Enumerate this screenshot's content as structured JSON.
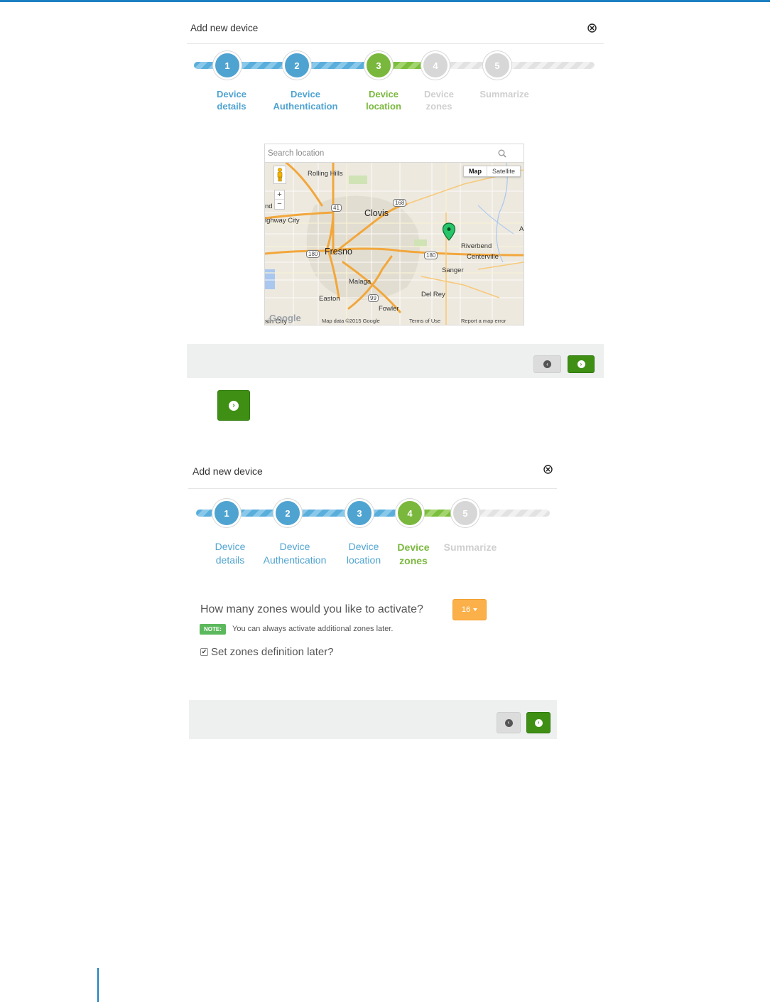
{
  "colors": {
    "accent_blue": "#4fa3d1",
    "accent_green": "#7ab83d",
    "inactive_gray": "#d7d7d7",
    "next_button": "#3e8f14",
    "dropdown_orange": "#fbb04a",
    "note_green": "#5cb85c"
  },
  "dialog1": {
    "title": "Add new device",
    "close_icon": "circle-x-icon",
    "steps": [
      {
        "number": "1",
        "label_line1": "Device",
        "label_line2": "details",
        "state": "done"
      },
      {
        "number": "2",
        "label_line1": "Device",
        "label_line2": "Authentication",
        "state": "done"
      },
      {
        "number": "3",
        "label_line1": "Device",
        "label_line2": "location",
        "state": "active"
      },
      {
        "number": "4",
        "label_line1": "Device",
        "label_line2": "zones",
        "state": "pending"
      },
      {
        "number": "5",
        "label_line1": "Summarize",
        "label_line2": "",
        "state": "pending"
      }
    ],
    "map": {
      "search_placeholder": "Search location",
      "map_type_map": "Map",
      "map_type_satellite": "Satellite",
      "zoom_in": "+",
      "zoom_out": "−",
      "places": {
        "rolling_hills": "Rolling Hills",
        "clovis": "Clovis",
        "highway_city": "ighway City",
        "fresno": "Fresno",
        "riverbend": "Riverbend",
        "centerville": "Centerville",
        "sanger": "Sanger",
        "malaga": "Malaga",
        "easton": "Easton",
        "del_rey": "Del Rey",
        "fowler": "Fowler",
        "basin_city": "sin City",
        "edge_nd": "nd",
        "edge_a": "A"
      },
      "route_badges": {
        "r41": "41",
        "r168": "168",
        "r180a": "180",
        "r180b": "180",
        "r99": "99"
      },
      "google_logo": "Google",
      "attribution": {
        "map_data": "Map data ©2015 Google",
        "terms": "Terms of Use",
        "report": "Report a map error"
      }
    },
    "back_icon": "arrow-left-circle-icon",
    "next_icon": "arrow-right-circle-icon"
  },
  "standalone_next": {
    "icon": "arrow-right-circle-icon"
  },
  "dialog2": {
    "title": "Add new device",
    "close_icon": "circle-x-icon",
    "steps": [
      {
        "number": "1",
        "label_line1": "Device",
        "label_line2": "details",
        "state": "done"
      },
      {
        "number": "2",
        "label_line1": "Device",
        "label_line2": "Authentication",
        "state": "done"
      },
      {
        "number": "3",
        "label_line1": "Device",
        "label_line2": "location",
        "state": "done"
      },
      {
        "number": "4",
        "label_line1": "Device",
        "label_line2": "zones",
        "state": "active"
      },
      {
        "number": "5",
        "label_line1": "Summarize",
        "label_line2": "",
        "state": "pending"
      }
    ],
    "question": "How many zones would you like to activate?",
    "zones_selected": "16",
    "note_badge": "NOTE:",
    "note_text": "You can always activate additional zones later.",
    "set_later_label": "Set zones definition later?",
    "set_later_checked": true,
    "back_icon": "arrow-left-circle-icon",
    "next_icon": "arrow-right-circle-icon"
  }
}
